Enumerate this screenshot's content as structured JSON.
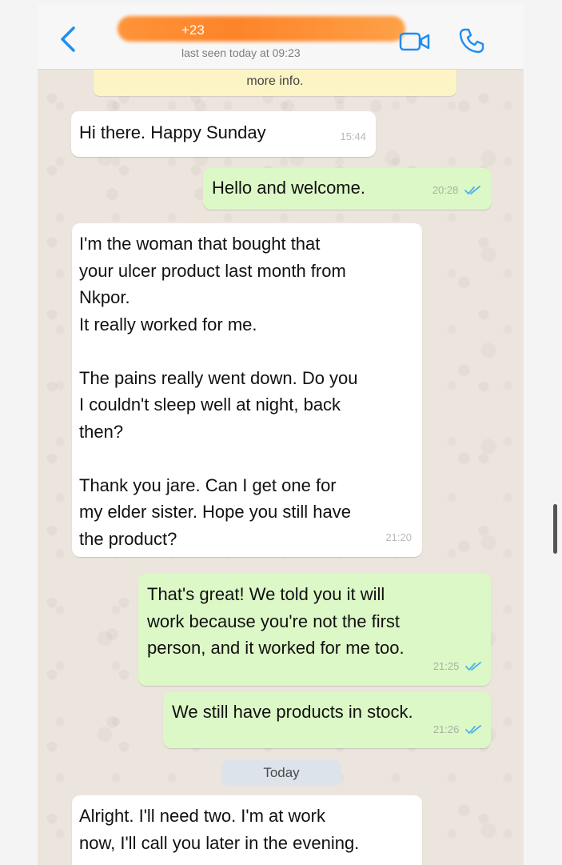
{
  "header": {
    "contact_name": "+23",
    "last_seen": "last seen today at 09:23"
  },
  "banner": {
    "text": "more info."
  },
  "messages": [
    {
      "direction": "in",
      "text": "Hi there. Happy Sunday",
      "time": "15:44"
    },
    {
      "direction": "out",
      "text": "Hello and welcome.",
      "time": "20:28",
      "status": "read"
    },
    {
      "direction": "in",
      "text": "I'm the woman that bought that\nyour ulcer product last month from\nNkpor.\nIt really worked for me.\n\nThe pains really went down. Do you\nI couldn't sleep well at night, back\nthen?\n\nThank you jare. Can I get one for\nmy elder sister. Hope you still have\nthe product?",
      "time": "21:20"
    },
    {
      "direction": "out",
      "text": "That's great! We told you it will\nwork because you're not the first\nperson, and it worked for me too.",
      "time": "21:25",
      "status": "read"
    },
    {
      "direction": "out",
      "text": "We still have products in stock.",
      "time": "21:26",
      "status": "read"
    },
    {
      "direction": "in",
      "text": "Alright. I'll need two. I'm at work\nnow, I'll call you later in the evening."
    }
  ],
  "date_separator": "Today",
  "colors": {
    "accent": "#1f8ef1",
    "incoming_bubble": "#ffffff",
    "outgoing_bubble": "#dcf8c6",
    "chat_background": "#ece5dd",
    "read_ticks": "#4fb3e8",
    "redaction": "#ff8c2a"
  },
  "icons": {
    "back": "chevron-left-icon",
    "video": "video-camera-icon",
    "call": "phone-icon",
    "ticks": "double-check-icon"
  }
}
